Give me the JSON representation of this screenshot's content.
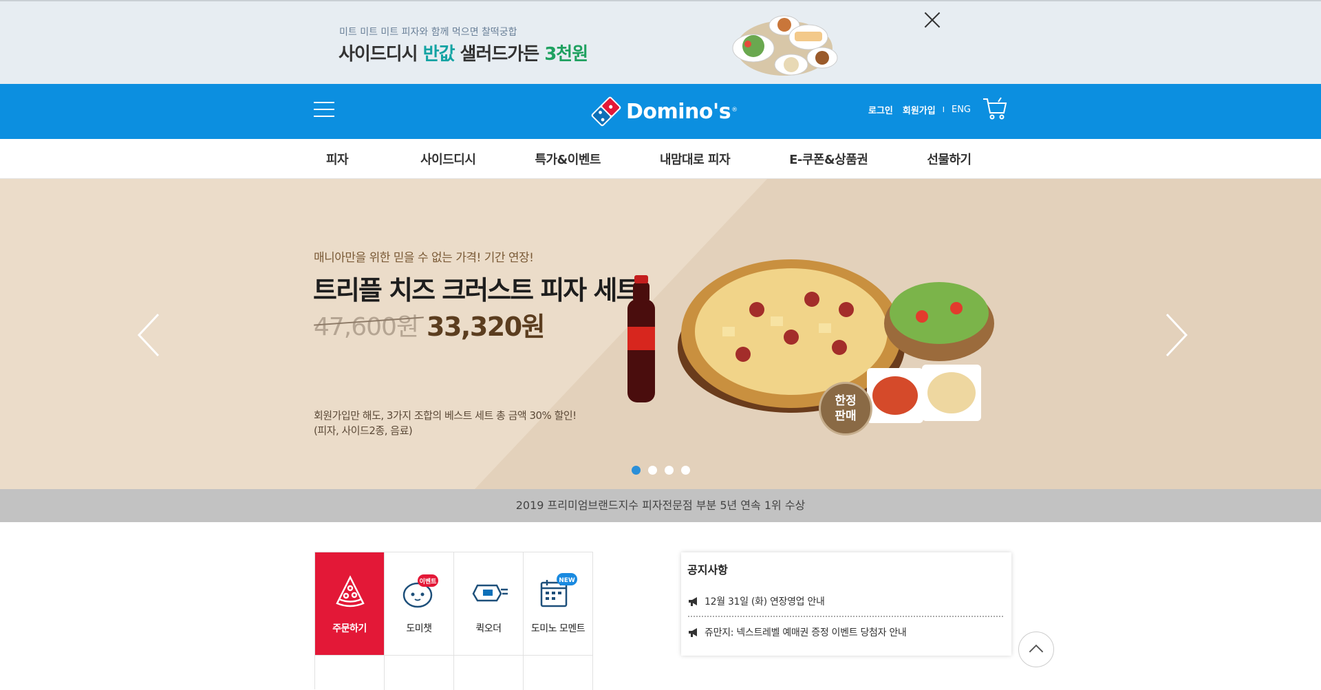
{
  "promo": {
    "subtitle": "미트 미트 미트 피자와 함께 먹으면 찰떡궁합",
    "title_part1": "사이드디시 ",
    "title_part2": "반값",
    "title_part3": " 샐러드가든 ",
    "title_part4": "3천원",
    "accent_teal": "#13a3a3",
    "accent_green": "#1fa160"
  },
  "header": {
    "brand": "Domino's",
    "login": "로그인",
    "signup": "회원가입",
    "separator": "I",
    "language": "ENG",
    "brand_color": "#0c8fe0"
  },
  "nav": {
    "items": [
      {
        "label": "피자"
      },
      {
        "label": "사이드디시"
      },
      {
        "label": "특가&이벤트"
      },
      {
        "label": "내맘대로 피자"
      },
      {
        "label": "E-쿠폰&상품권"
      },
      {
        "label": "선물하기"
      }
    ]
  },
  "hero": {
    "subtitle": "매니아만을 위한 믿을 수 없는 가격! 기간 연장!",
    "title": "트리플 치즈 크러스트 피자 세트",
    "old_price": "47,600원",
    "new_price": "33,320원",
    "desc_line1": "회원가입만 해도, 3가지 조합의 베스트 세트 총 금액 30% 할인!",
    "desc_line2": "(피자, 사이드2종, 음료)",
    "badge_line1": "한정",
    "badge_line2": "판매",
    "slide_count": 4,
    "active_slide": 1
  },
  "award": {
    "text": "2019 프리미엄브랜드지수 피자전문점 부분 5년 연속 1위 수상"
  },
  "quick_menu": {
    "items": [
      {
        "label": "주문하기",
        "icon": "pizza-slice-icon"
      },
      {
        "label": "도미챗",
        "icon": "chatbot-icon",
        "badge": "이벤트"
      },
      {
        "label": "퀵오더",
        "icon": "quick-order-icon"
      },
      {
        "label": "도미노 모멘트",
        "icon": "calendar-icon",
        "badge": "NEW"
      }
    ],
    "accent_red": "#e31837"
  },
  "notice": {
    "title": "공지사항",
    "items": [
      {
        "text": "12월 31일 (화) 연장영업 안내"
      },
      {
        "text": "쥬만지: 넥스트레벨 예매권 증정 이벤트 당첨자 안내"
      }
    ]
  }
}
